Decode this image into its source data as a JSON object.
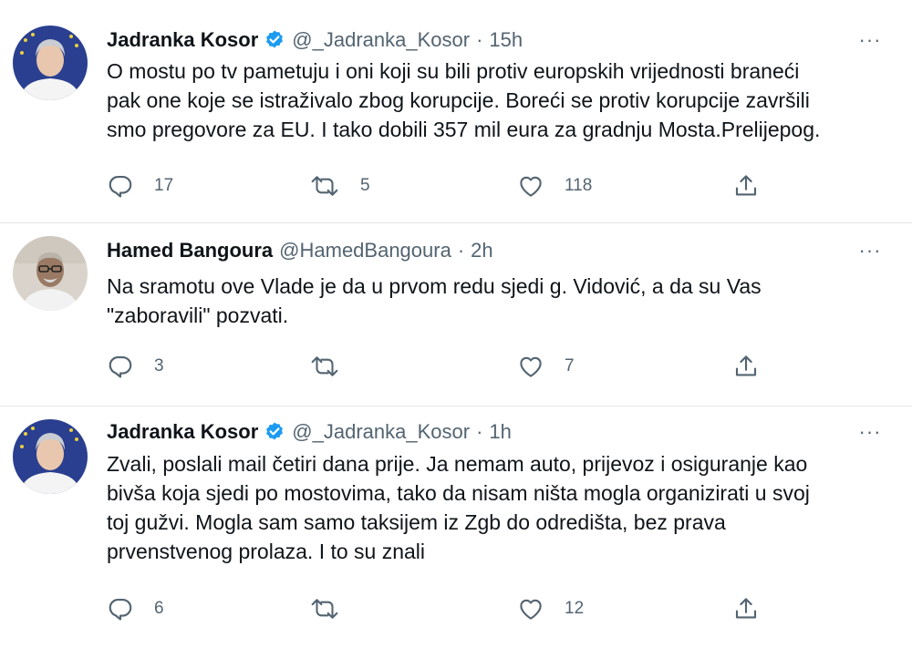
{
  "colors": {
    "verified": "#1d9bf0",
    "secondary_text": "#536471",
    "primary_text": "#0f1419",
    "divider": "#e1e6ea"
  },
  "tweets": [
    {
      "name": "Jadranka Kosor",
      "verified": true,
      "handle": "@_Jadranka_Kosor",
      "separator": "·",
      "time": "15h",
      "more": "···",
      "lines": [
        "O mostu po tv pametuju i oni koji su bili protiv europskih vrijednosti braneći",
        "pak one koje se istraživalo zbog korupcije. Boreći se protiv korupcije završili",
        "smo pregovore za EU. I tako dobili 357 mil eura za gradnju Mosta.Prelijepog."
      ],
      "replies": "17",
      "retweets": "5",
      "likes": "118"
    },
    {
      "name": "Hamed Bangoura",
      "verified": false,
      "handle": "@HamedBangoura",
      "separator": "·",
      "time": "2h",
      "more": "···",
      "lines": [
        "Na sramotu ove Vlade je da u prvom redu sjedi g. Vidović, a da su Vas",
        "\"zaboravili\" pozvati."
      ],
      "replies": "3",
      "retweets": "",
      "likes": "7"
    },
    {
      "name": "Jadranka Kosor",
      "verified": true,
      "handle": "@_Jadranka_Kosor",
      "separator": "·",
      "time": "1h",
      "more": "···",
      "lines": [
        "Zvali, poslali mail četiri dana prije. Ja nemam auto, prijevoz i osiguranje kao",
        "bivša koja sjedi po mostovima, tako da nisam ništa mogla organizirati u svoj",
        "toj gužvi. Mogla sam samo taksijem iz Zgb do odredišta, bez prava",
        "prvenstvenog prolaza. I to su znali"
      ],
      "replies": "6",
      "retweets": "",
      "likes": "12"
    }
  ]
}
